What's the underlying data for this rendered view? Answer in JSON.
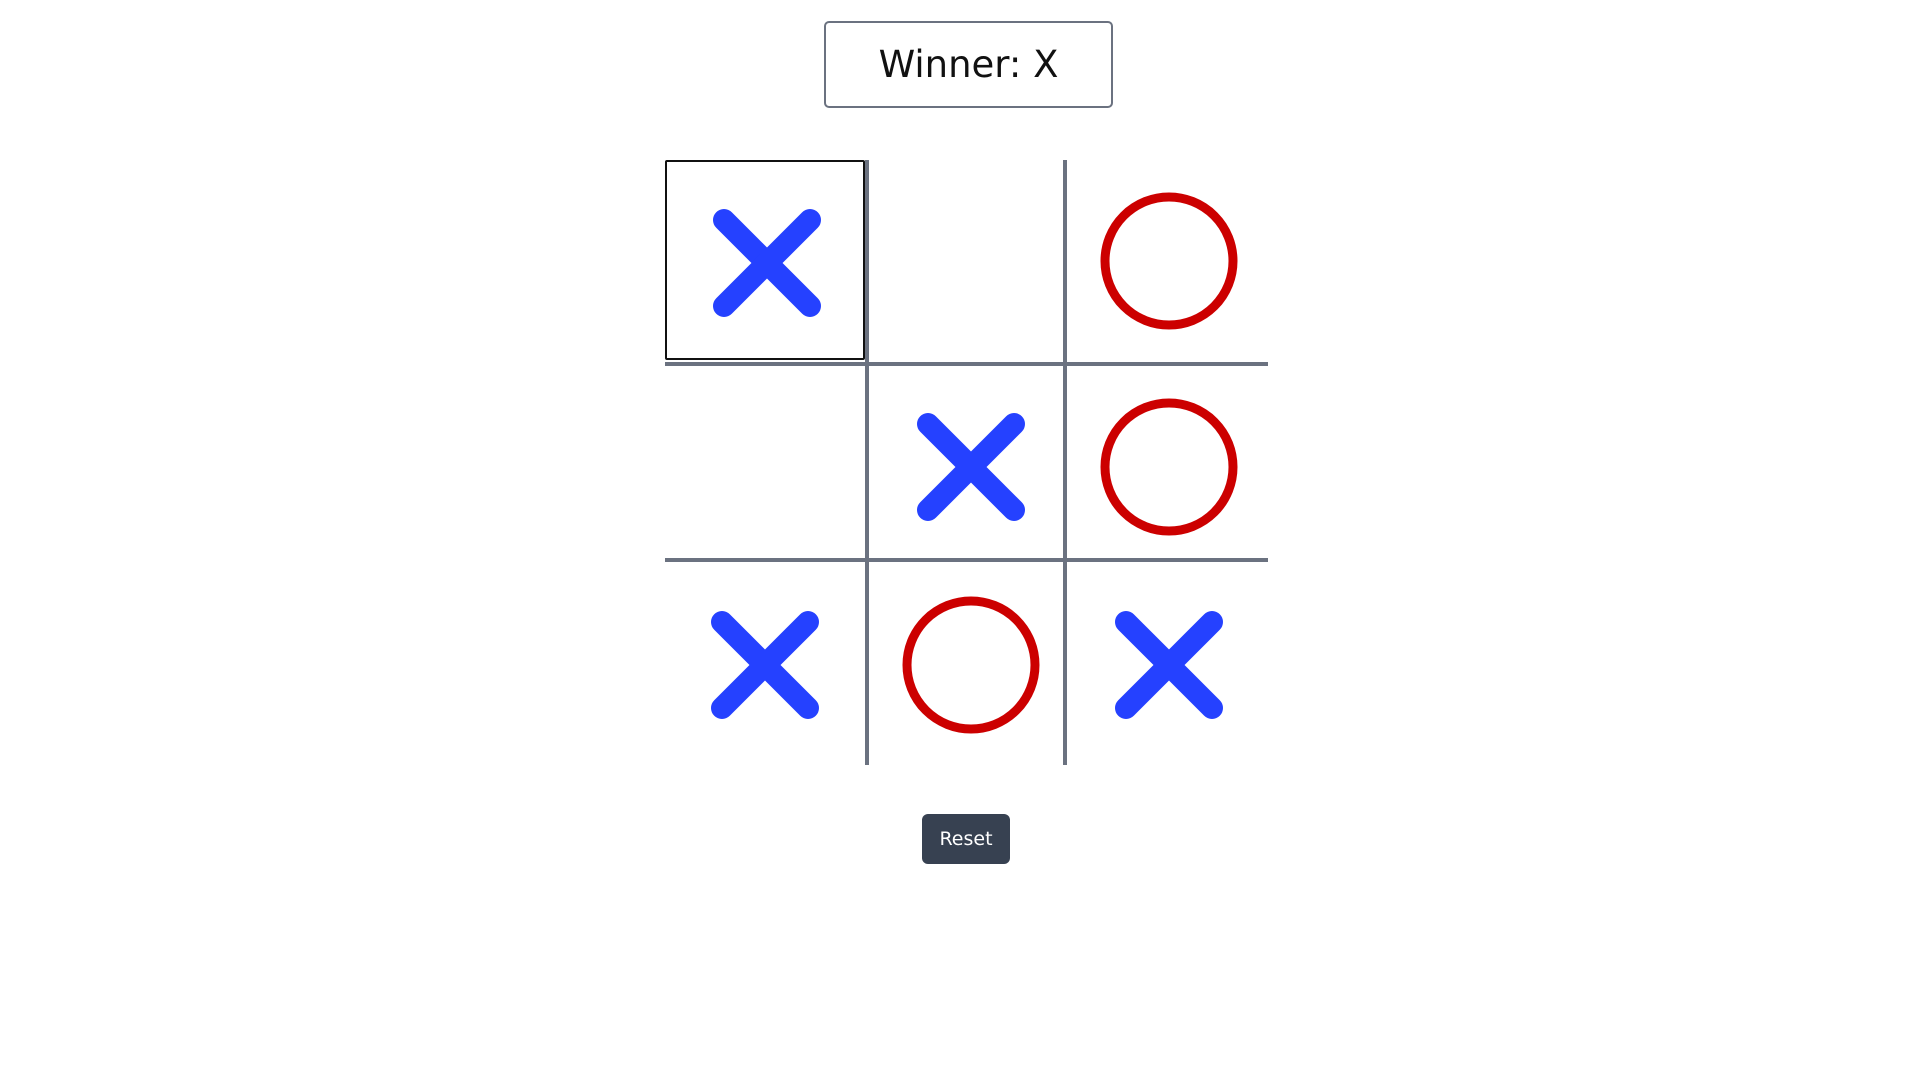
{
  "status": {
    "text": "Winner: X"
  },
  "board": {
    "cells": [
      "X",
      "",
      "O",
      "",
      "X",
      "O",
      "X",
      "O",
      "X"
    ],
    "focused_cell": 0,
    "line_color": "#6b7280"
  },
  "marks": {
    "X": {
      "icon": "x-mark-icon",
      "color": "#2541ff"
    },
    "O": {
      "icon": "o-mark-icon",
      "color": "#cc0000"
    }
  },
  "controls": {
    "reset_label": "Reset"
  }
}
